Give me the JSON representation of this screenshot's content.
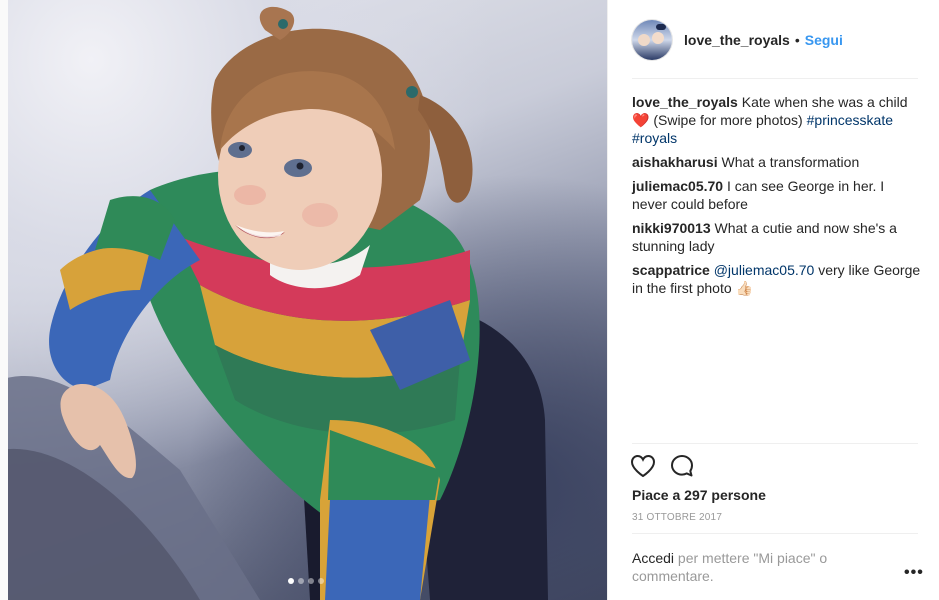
{
  "post": {
    "username": "love_the_royals",
    "separator": "•",
    "follow_label": "Segui",
    "carousel": {
      "total": 4,
      "active": 1
    }
  },
  "caption": {
    "user": "love_the_royals",
    "text_before": "Kate when she was a child",
    "emoji": "❤️",
    "text_after": "(Swipe for more photos)",
    "hashtags": [
      "#princesskate",
      "#royals"
    ]
  },
  "comments": [
    {
      "user": "aishakharusi",
      "text": "What a transformation"
    },
    {
      "user": "juliemac05.70",
      "text": "I can see George in her. I never could before"
    },
    {
      "user": "nikki970013",
      "text": "What a cutie and now she's a stunning lady"
    },
    {
      "user": "scappatrice",
      "mention": "@juliemac05.70",
      "text": "very like George in the first photo",
      "emoji": "👍🏻"
    }
  ],
  "actions": {
    "like_icon": "heart-outline-icon",
    "comment_icon": "speech-bubble-icon"
  },
  "likes_label": "Piace a 297 persone",
  "date_label": "31 OTTOBRE 2017",
  "footer": {
    "login_label": "Accedi",
    "rest_text": "per mettere \"Mi piace\" o commentare.",
    "more_label": "•••"
  },
  "colors": {
    "link_blue": "#3897f0",
    "hashtag_blue": "#003569",
    "muted_gray": "#999999",
    "text_dark": "#262626"
  }
}
